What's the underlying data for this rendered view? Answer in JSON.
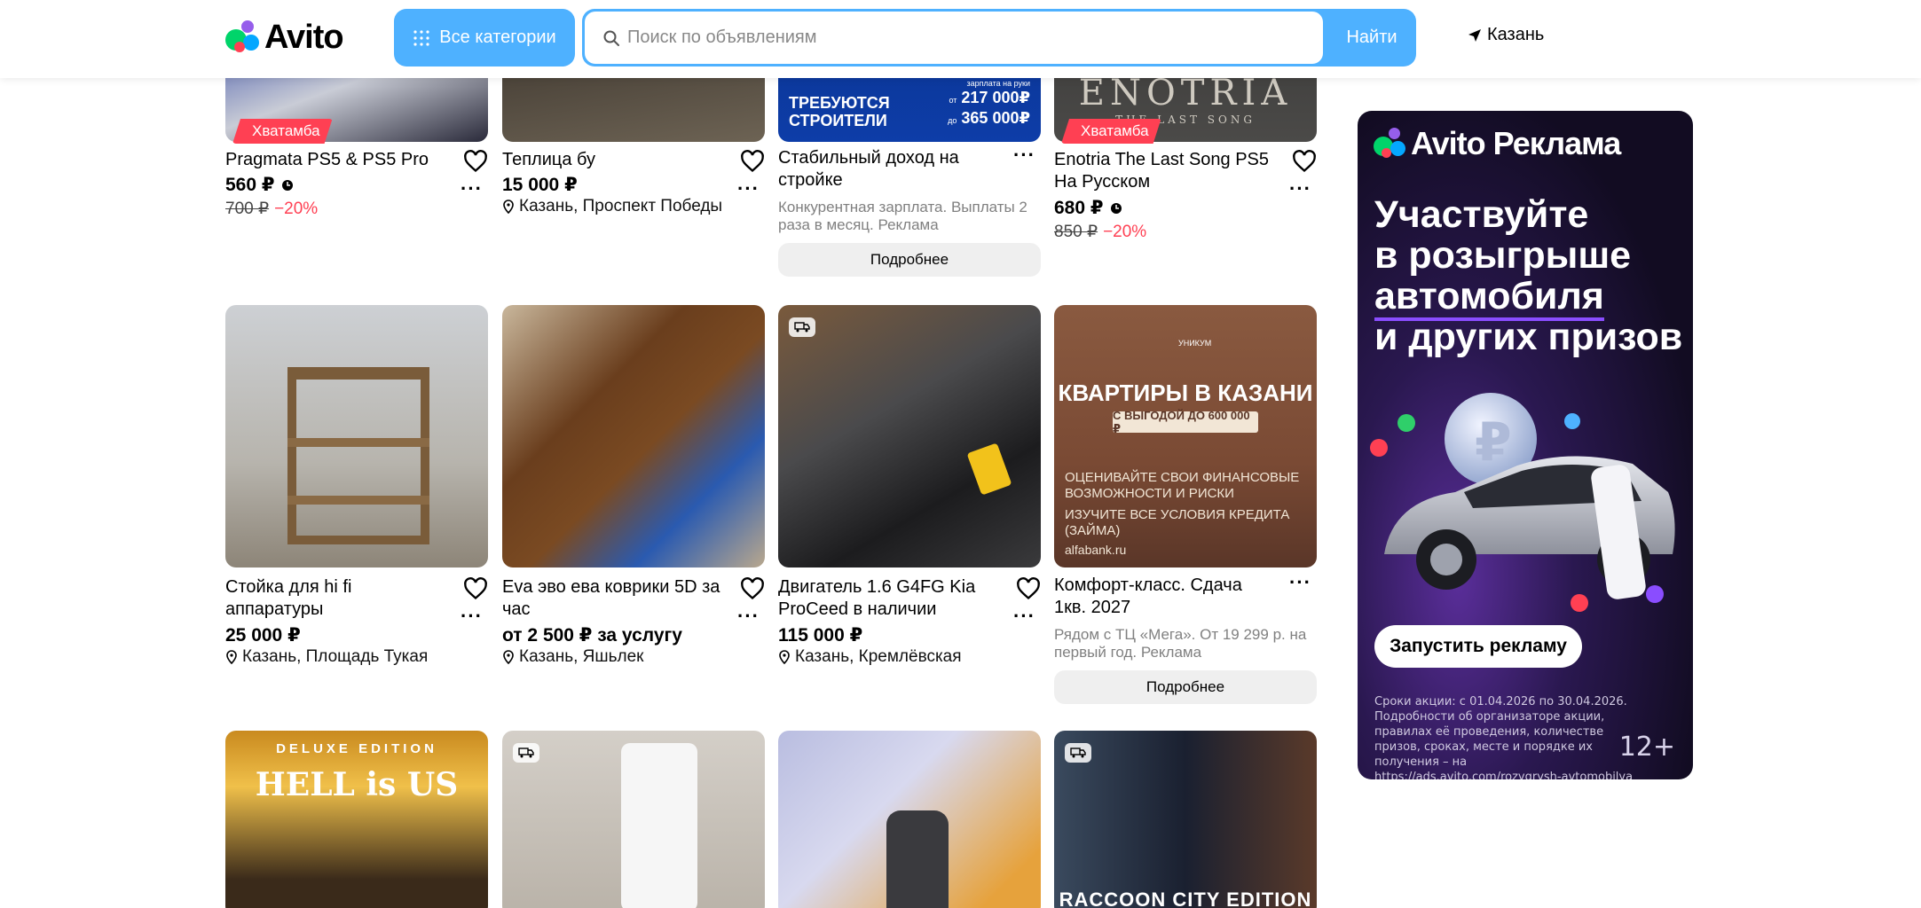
{
  "header": {
    "logo_text": "Avito",
    "categories_label": "Все категории",
    "search_placeholder": "Поиск по объявлениям",
    "search_button": "Найти",
    "location": "Казань"
  },
  "cards": [
    {
      "title": "Pragmata PS5 & PS5 Pro",
      "price": "560 ₽",
      "old_price": "700 ₽",
      "discount": "−20%",
      "badge": "Хватамба"
    },
    {
      "title": "Теплица бу",
      "price": "15 000 ₽",
      "location": "Казань, Проспект Победы"
    },
    {
      "title": "Стабильный доход на стройке",
      "desc": "Конкурентная зарплата. Выплаты 2 раза в месяц. Реклама",
      "button": "Подробнее",
      "img_line1": "Требуются",
      "img_line2": "строители",
      "img_sal1": "217 000₽",
      "img_sal2": "365 000₽",
      "img_sal_note": "зарплата на руки",
      "img_from": "от",
      "img_to": "до"
    },
    {
      "title": "Enotria The Last Song PS5 На Русском",
      "price": "680 ₽",
      "old_price": "850 ₽",
      "discount": "−20%",
      "badge": "Хватамба",
      "img_text": "ENOTRIA",
      "img_sub": "THE LAST SONG"
    },
    {
      "title": "Стойка для hi fi аппаратуры",
      "price": "25 000 ₽",
      "location": "Казань, Площадь Тукая"
    },
    {
      "title": "Eva эво ева коврики 5D за час",
      "price": "от 2 500 ₽ за услугу",
      "location": "Казань, Яшьлек"
    },
    {
      "title": "Двигатель 1.6 G4FG Kia ProCeed в наличии",
      "price": "115 000 ₽",
      "location": "Казань, Кремлёвская"
    },
    {
      "title": "Комфорт-класс. Сдача 1кв. 2027",
      "desc": "Рядом с ТЦ «Мега». От 19 299 р. на первый год. Реклама",
      "button": "Подробнее",
      "img_brand": "УНИКУМ",
      "img_h1": "КВАРТИРЫ В КАЗАНИ",
      "img_h2": "С ВЫГОДОЙ ДО 600 000 ₽",
      "img_h3": "ОЦЕНИВАЙТЕ СВОИ ФИНАНСОВЫЕ ВОЗМОЖНОСТИ И РИСКИ",
      "img_h4": "ИЗУЧИТЕ ВСЕ УСЛОВИЯ КРЕДИТА (ЗАЙМА)",
      "img_h5": "alfabank.ru"
    },
    {
      "img_top": "DELUXE EDITION",
      "img_title": "HELL is US"
    },
    {},
    {},
    {
      "img_text": "RACCOON CITY EDITION"
    }
  ],
  "ad": {
    "logo_text": "Avito Реклама",
    "headline_1": "Участвуйте",
    "headline_2": "в розыгрыше",
    "headline_3": "автомобиля",
    "headline_4": "и других призов",
    "button": "Запустить рекламу",
    "legal": "Сроки акции: с 01.04.2026 по 30.04.2026. Подробности об организаторе акции, правилах её проведения, количестве призов, сроках, месте и порядке их получения – на https://ads.avito.com/rozygrysh-avtomobilya",
    "age": "12+"
  },
  "colors": {
    "accent": "#4eb1ff",
    "sale": "#ff4053",
    "ad_bg": "#1a1030"
  }
}
